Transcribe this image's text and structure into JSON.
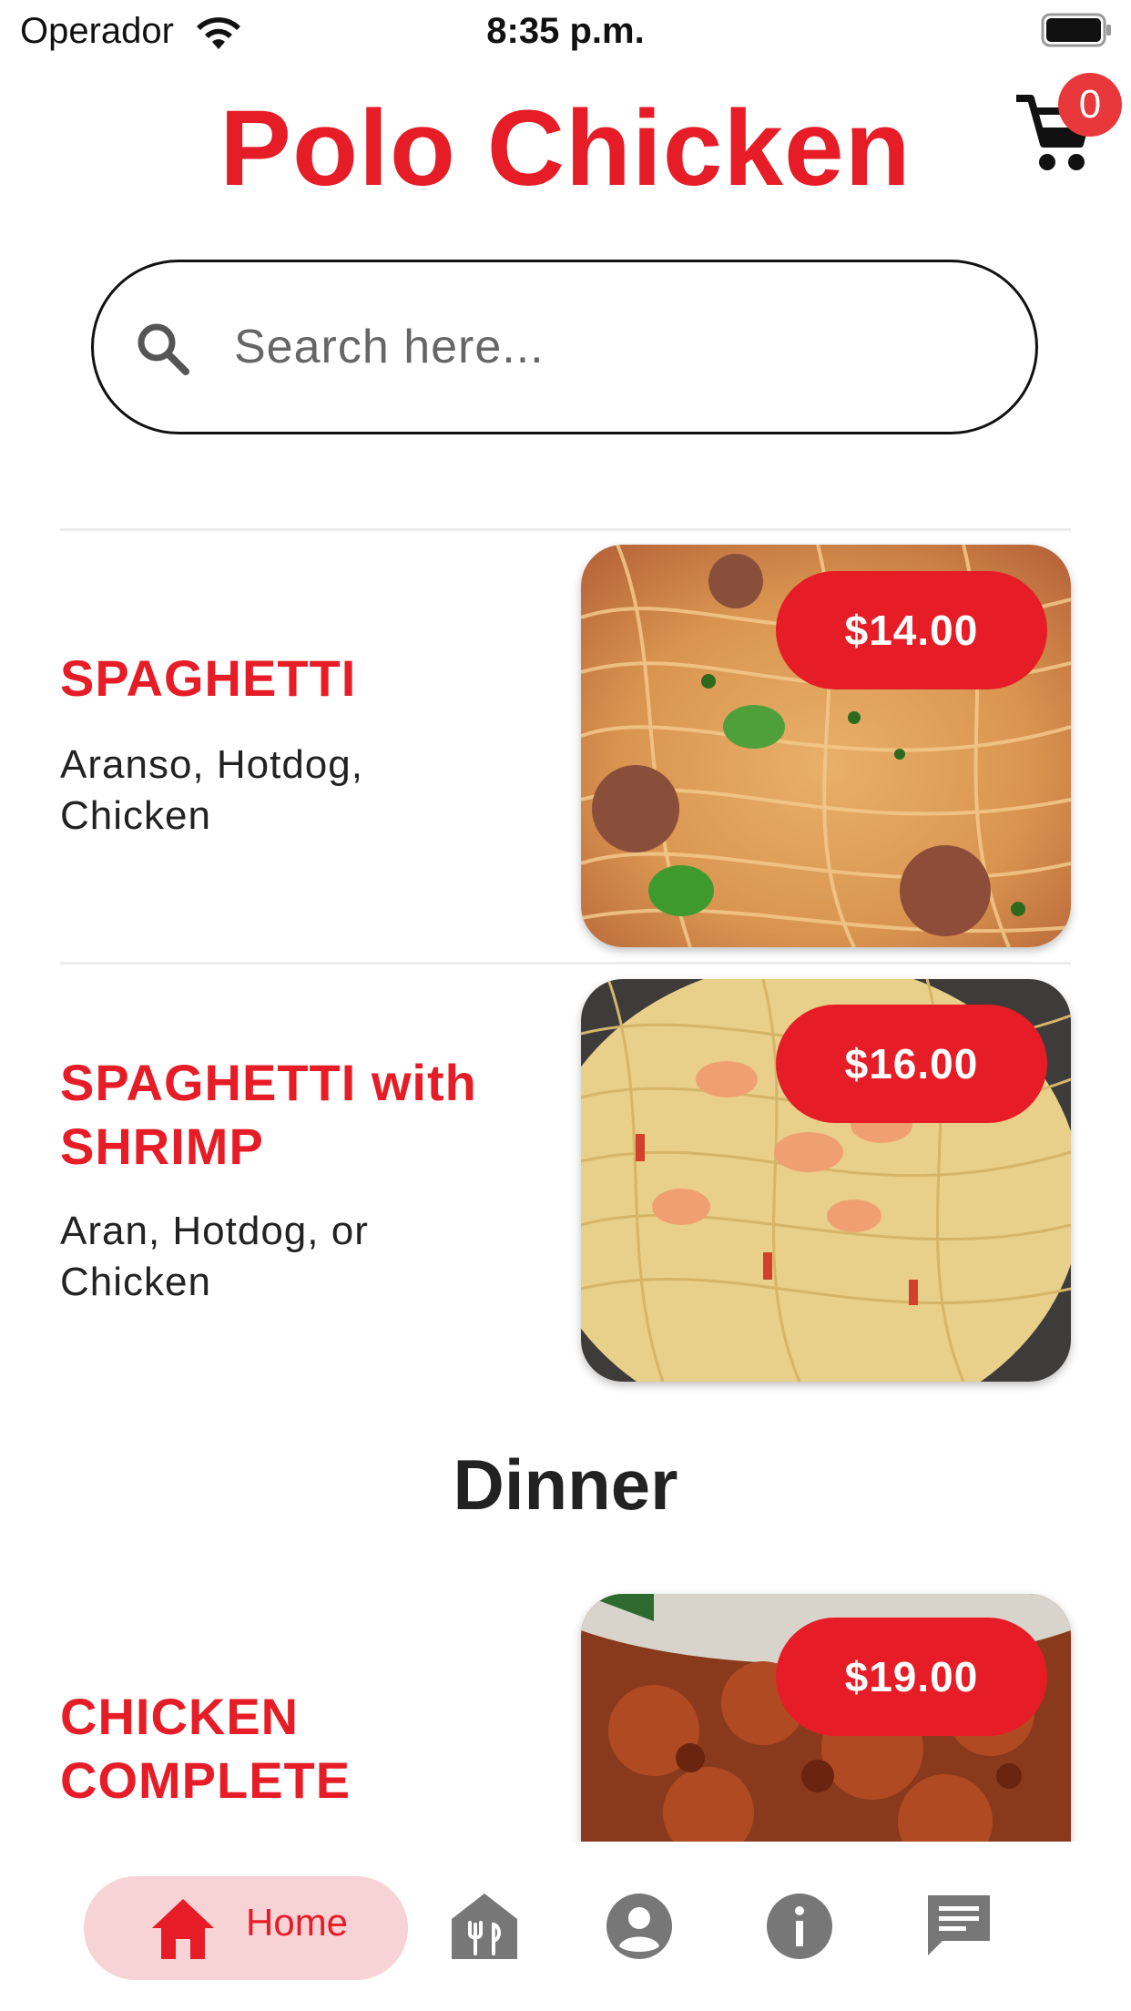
{
  "status_bar": {
    "carrier": "Operador",
    "time": "8:35 p.m."
  },
  "header": {
    "title": "Polo Chicken",
    "cart_count": "0"
  },
  "search": {
    "placeholder": "Search here..."
  },
  "menu_items": [
    {
      "title_lines": [
        "SPAGHETTI"
      ],
      "desc_lines": [
        "Aranso, Hotdog,",
        "Chicken"
      ],
      "price": "$14.00"
    },
    {
      "title_lines": [
        "SPAGHETTI with",
        "SHRIMP"
      ],
      "desc_lines": [
        "Aran, Hotdog, or",
        "Chicken"
      ],
      "price": "$16.00"
    },
    {
      "title_lines": [
        "CHICKEN",
        "COMPLETE"
      ],
      "desc_lines": [],
      "price": "$19.00"
    }
  ],
  "sections": {
    "dinner": "Dinner"
  },
  "bottom_nav": {
    "items": [
      {
        "label": "Home",
        "icon": "home-icon",
        "active": true
      },
      {
        "label": "",
        "icon": "restaurant-icon",
        "active": false
      },
      {
        "label": "",
        "icon": "account-icon",
        "active": false
      },
      {
        "label": "",
        "icon": "info-icon",
        "active": false
      },
      {
        "label": "",
        "icon": "chat-icon",
        "active": false
      }
    ]
  },
  "colors": {
    "accent": "#e61c26",
    "active_pill": "#f8d3d5",
    "inactive_icon": "#777777"
  }
}
